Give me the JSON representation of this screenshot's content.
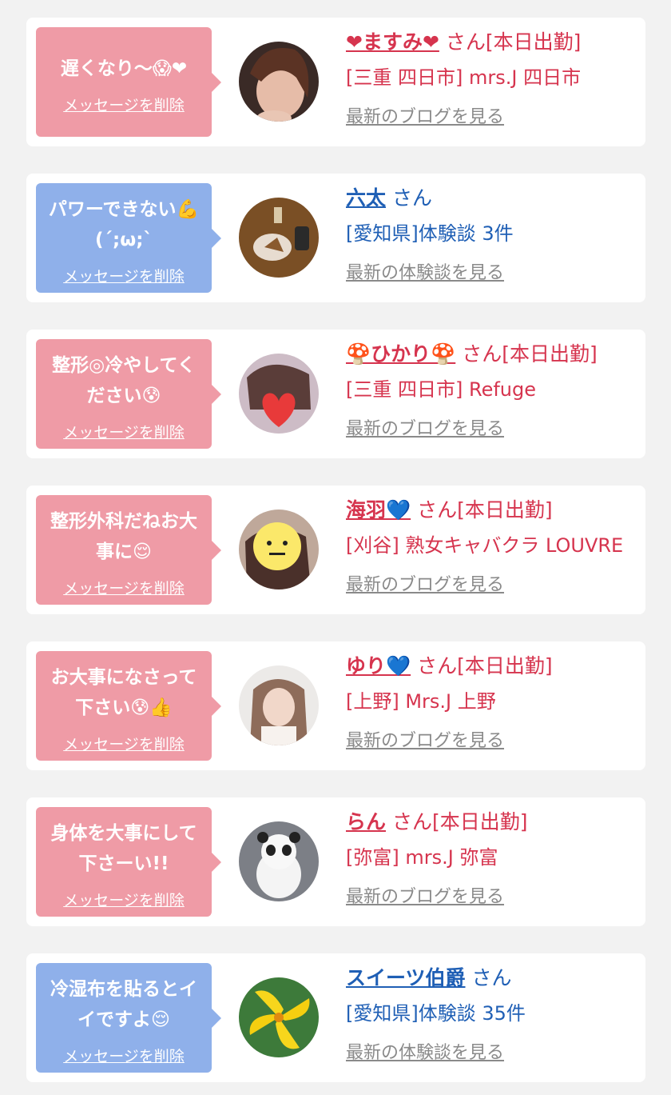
{
  "delete_label": "メッセージを削除",
  "cards": [
    {
      "bubble_text": "遅くなり〜😱❤",
      "name": "❤ますみ❤",
      "san": "さん[本日出勤]",
      "shop": "[三重 四日市] mrs.J 四日市",
      "latest": "最新のブログを見る",
      "avatar_desc": "woman-photo"
    },
    {
      "bubble_text": "パワーできない💪 (´;ω;`",
      "name": "六太",
      "san": "さん",
      "shop": "[愛知県]体験談 3件",
      "latest": "最新の体験談を見る",
      "avatar_desc": "food-photo"
    },
    {
      "bubble_text": "整形◎冷やしてください😰",
      "name": "🍄ひかり🍄",
      "san": "さん[本日出勤]",
      "shop": "[三重 四日市] Refuge",
      "latest": "最新のブログを見る",
      "avatar_desc": "woman-photo-heart"
    },
    {
      "bubble_text": "整形外科だねお大事に😌",
      "name": "海羽💙",
      "san": "さん[本日出勤]",
      "shop": "[刈谷] 熟女キャバクラ LOUVRE",
      "latest": "最新のブログを見る",
      "avatar_desc": "woman-photo-smiley"
    },
    {
      "bubble_text": "お大事になさって下さい😰👍",
      "name": "ゆり💙",
      "san": "さん[本日出勤]",
      "shop": "[上野] Mrs.J 上野",
      "latest": "最新のブログを見る",
      "avatar_desc": "woman-photo"
    },
    {
      "bubble_text": "身体を大事にして下さーい!!",
      "name": "らん",
      "san": "さん[本日出勤]",
      "shop": "[弥富] mrs.J 弥富",
      "latest": "最新のブログを見る",
      "avatar_desc": "panda-plush-photo"
    },
    {
      "bubble_text": "冷湿布を貼るとイイですよ😌",
      "name": "スイーツ伯爵",
      "san": "さん",
      "shop": "[愛知県]体験談 35件",
      "latest": "最新の体験談を見る",
      "avatar_desc": "yellow-flower-photo"
    }
  ],
  "colors": {
    "pink_text": "#d6344e",
    "blue_text": "#1f5fb5",
    "pink_bubble": "#ef9ba6",
    "blue_bubble": "#8fb0ea",
    "link_gray": "#8a8a8a",
    "page_bg": "#f2f2f2"
  }
}
